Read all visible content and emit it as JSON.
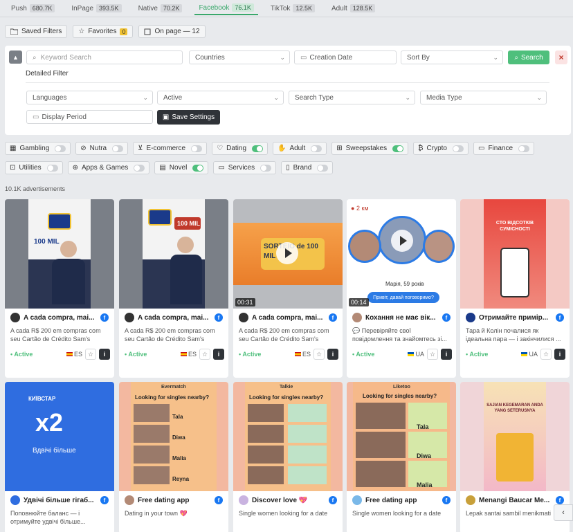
{
  "tabs": [
    {
      "label": "Push",
      "count": "680.7K",
      "active": false
    },
    {
      "label": "InPage",
      "count": "393.5K",
      "active": false
    },
    {
      "label": "Native",
      "count": "70.2K",
      "active": false
    },
    {
      "label": "Facebook",
      "count": "76.1K",
      "active": true
    },
    {
      "label": "TikTok",
      "count": "12.5K",
      "active": false
    },
    {
      "label": "Adult",
      "count": "128.5K",
      "active": false
    }
  ],
  "toolbar": {
    "saved_filters": "Saved Filters",
    "favorites": "Favorites",
    "favorites_count": "0",
    "on_page": "On page — 12"
  },
  "filters": {
    "keyword_placeholder": "Keyword Search",
    "countries": "Countries",
    "creation_date": "Creation Date",
    "sort_by": "Sort By",
    "search_label": "Search",
    "detailed_filter": "Detailed Filter",
    "languages": "Languages",
    "active": "Active",
    "search_type": "Search Type",
    "media_type": "Media Type",
    "display_period": "Display Period",
    "save_settings": "Save Settings"
  },
  "categories_row1": [
    {
      "label": "Gambling",
      "on": false
    },
    {
      "label": "Nutra",
      "on": false
    },
    {
      "label": "E-commerce",
      "on": false
    },
    {
      "label": "Dating",
      "on": true
    },
    {
      "label": "Adult",
      "on": false
    },
    {
      "label": "Sweepstakes",
      "on": true
    },
    {
      "label": "Crypto",
      "on": false
    },
    {
      "label": "Finance",
      "on": false
    }
  ],
  "categories_row2": [
    {
      "label": "Utilities",
      "on": false
    },
    {
      "label": "Apps & Games",
      "on": false
    },
    {
      "label": "Novel",
      "on": true
    },
    {
      "label": "Services",
      "on": false
    },
    {
      "label": "Brand",
      "on": false
    }
  ],
  "ad_count": "10.1K advertisements",
  "cards_row1": [
    {
      "title": "A cada compra, mai...",
      "desc": "A cada R$ 200 em compras com seu Cartão de Crédito Sam's Club...",
      "status": "• Active",
      "geo": "ES",
      "duration": ""
    },
    {
      "title": "A cada compra, mai...",
      "desc": "A cada R$ 200 em compras com seu Cartão de Crédito Sam's Club...",
      "status": "• Active",
      "geo": "ES",
      "duration": ""
    },
    {
      "title": "A cada compra, mai...",
      "desc": "A cada R$ 200 em compras com seu Cartão de Crédito Sam's Club...",
      "status": "• Active",
      "geo": "ES",
      "duration": "00:31"
    },
    {
      "title": "Кохання не має вік...",
      "desc": "💬 Перевіряйте свої повідомлення та знайомтесь зі...",
      "status": "• Active",
      "geo": "UA",
      "duration": "00:14"
    },
    {
      "title": "Отримайте примір...",
      "desc": "Тара й Колін почалися як ідеальна пара — і закінчилися ...",
      "status": "• Active",
      "geo": "UA",
      "duration": ""
    }
  ],
  "cards_row2": [
    {
      "title": "Удвічі більше гігаб...",
      "desc": "Поповнюйте баланс — і отримуйте удвічі більше..."
    },
    {
      "title": "Free dating app",
      "desc": "Dating in your town 💖"
    },
    {
      "title": "Discover love 💖",
      "desc": "Single women looking for a date"
    },
    {
      "title": "Free dating app",
      "desc": "Single women looking for a date"
    },
    {
      "title": "Menangi Baucar Me...",
      "desc": "Lepak santai sambil menikmati"
    }
  ],
  "thumb_text": {
    "sorteio": "SORTEIO de 100 MIL",
    "seal": "100 MIL",
    "distance": "2 км",
    "person": "Марія, 59 років",
    "chat": "Привіт, давай поговоримо?",
    "promo": "СТО ВІДСОТКІВ СУМІСНОСТІ",
    "kyivstar": "КИЇВСТАР",
    "x2": "x2",
    "more": "Вдвічі більше",
    "evermatch": "Evermatch",
    "talkie": "Talkie",
    "liketoo": "Liketoo",
    "singles": "Looking for singles nearby?",
    "names": [
      "Tala",
      "Diwa",
      "Malia",
      "Reyna"
    ],
    "baucar": "SAJIAN KEGEMARAN ANDA YANG SETERUSNYA"
  },
  "colors": {
    "accent": "#4fbf7c",
    "dark": "#2f3338",
    "facebook": "#1877f2"
  }
}
